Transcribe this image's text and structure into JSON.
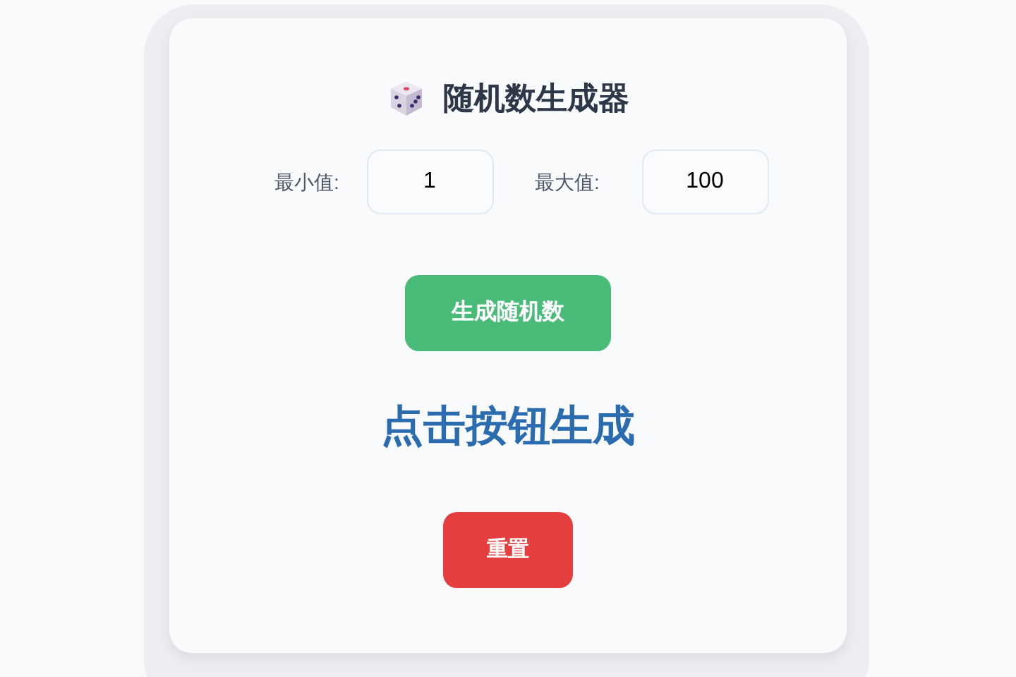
{
  "title": "随机数生成器",
  "min_field": {
    "label": "最小值:",
    "value": "1"
  },
  "max_field": {
    "label": "最大值:",
    "value": "100"
  },
  "generate_button": "生成随机数",
  "result": "点击按钮生成",
  "reset_button": "重置"
}
